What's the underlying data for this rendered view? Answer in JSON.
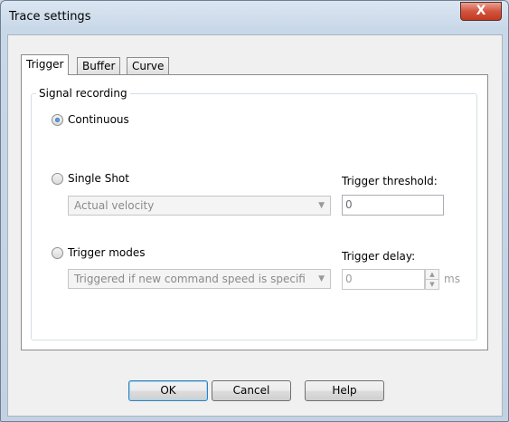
{
  "window": {
    "title": "Trace settings",
    "close_glyph": "X"
  },
  "tabs": [
    {
      "label": "Trigger",
      "active": true
    },
    {
      "label": "Buffer",
      "active": false
    },
    {
      "label": "Curve",
      "active": false
    }
  ],
  "group": {
    "legend": "Signal recording",
    "continuous": {
      "label": "Continuous",
      "checked": true
    },
    "single_shot": {
      "label": "Single Shot",
      "checked": false,
      "combo_value": "Actual velocity",
      "threshold_label": "Trigger threshold:",
      "threshold_value": "0"
    },
    "trigger_modes": {
      "label": "Trigger modes",
      "checked": false,
      "combo_value": "Triggered if new command speed is specifi",
      "delay_label": "Trigger delay:",
      "delay_value": "0",
      "delay_unit": "ms"
    }
  },
  "buttons": {
    "ok": "OK",
    "cancel": "Cancel",
    "help": "Help"
  },
  "icons": {
    "radio_selected": "radio-selected-icon",
    "dropdown": "chevron-down-icon",
    "spin": "spin-up-down-icon"
  },
  "colors": {
    "radio_dot": "#1f5fa9",
    "close_button": "#c2381f"
  }
}
